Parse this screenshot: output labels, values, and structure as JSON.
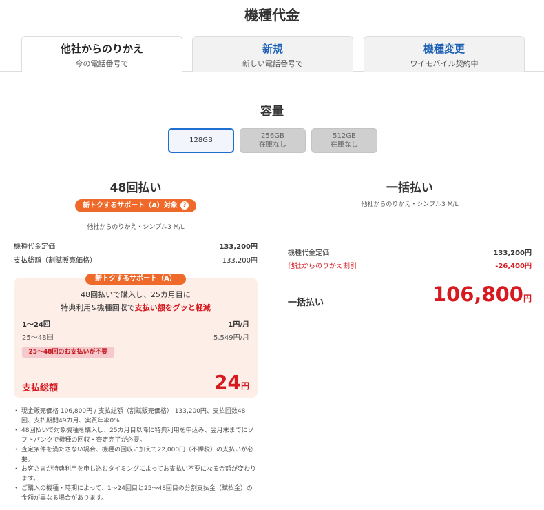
{
  "page_title": "機種代金",
  "tabs": [
    {
      "title": "他社からのりかえ",
      "sub": "今の電話番号で",
      "active": true
    },
    {
      "title": "新規",
      "sub": "新しい電話番号で",
      "active": false
    },
    {
      "title": "機種変更",
      "sub": "ワイモバイル契約中",
      "active": false
    }
  ],
  "capacity": {
    "title": "容量",
    "options": [
      {
        "label": "128GB",
        "status": "",
        "selected": true
      },
      {
        "label": "256GB",
        "status": "在庫なし",
        "selected": false
      },
      {
        "label": "512GB",
        "status": "在庫なし",
        "selected": false
      }
    ]
  },
  "installment": {
    "title": "48回払い",
    "badge": "新トクするサポート（A）対象",
    "help_icon": "?",
    "plan": "他社からのりかえ・シンプル3 M/L",
    "rows": [
      {
        "label": "機種代金定価",
        "value": "133,200円"
      },
      {
        "label": "支払総額（割賦販売価格）",
        "value": "133,200円"
      }
    ],
    "support": {
      "badge": "新トクするサポート（A）",
      "desc_line1": "48回払いで購入し、25カ月目に",
      "desc_line2_prefix": "特典利用&機種回収で",
      "desc_line2_highlight": "支払い額をグッと軽減",
      "periods": [
        {
          "label": "1〜24回",
          "value": "1円/月"
        },
        {
          "label": "25〜48回",
          "value": "5,549円/月"
        }
      ],
      "note_pill": "25〜48回のお支払いが不要",
      "total_label": "支払総額",
      "total_value": "24",
      "total_unit": "円"
    },
    "notes": [
      "現金販売価格 106,800円 / 支払総額（割賦販売価格） 133,200円、支払回数48回、支払期間49カ月、実質年率0%",
      "48回払いで対象機種を購入し、25カ月目以降に特典利用を申込み、翌月末までにソフトバンクで機種の回収・査定完了が必要。",
      "査定条件を満たさない場合、機種の回収に加えて22,000円（不課税）の支払いが必要。",
      "お客さまが特典利用を申し込むタイミングによってお支払い不要になる金額が変わります。",
      "ご購入の機種・時期によって、1〜24回目と25〜48回目の分割支払金（賦払金）の金額が異なる場合があります。"
    ]
  },
  "lump": {
    "title": "一括払い",
    "plan": "他社からのりかえ・シンプル3 M/L",
    "rows": [
      {
        "label": "機種代金定価",
        "value": "133,200円"
      },
      {
        "label": "他社からのりかえ割引",
        "value": "-26,400円"
      }
    ],
    "total_label": "一括払い",
    "total_value": "106,800",
    "total_unit": "円"
  },
  "colors": {
    "accent_blue": "#1e6fd0",
    "discount_red": "#d71920",
    "badge_orange": "#ef6a2a",
    "support_bg": "#fdeee8"
  }
}
